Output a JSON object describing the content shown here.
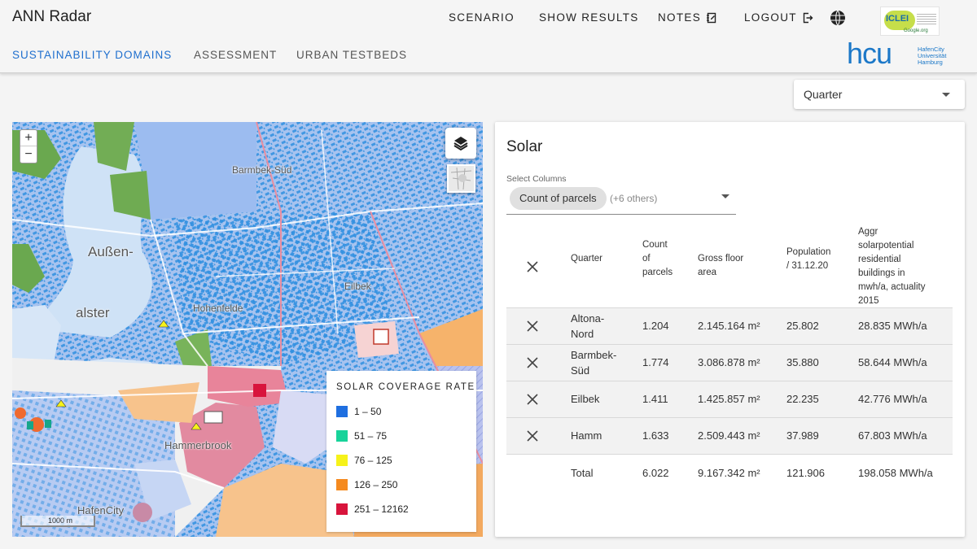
{
  "app": {
    "title": "ANN Radar"
  },
  "topnav": {
    "scenario": "SCENARIO",
    "show_results": "SHOW RESULTS",
    "notes": "NOTES",
    "logout": "LOGOUT"
  },
  "subnav": {
    "sustainability": "SUSTAINABILITY DOMAINS",
    "assessment": "ASSESSMENT",
    "testbeds": "URBAN TESTBEDS"
  },
  "logos": {
    "iclei": "ICLEI",
    "iclei_sub": "Google.org",
    "hcu_mark": "hcu",
    "hcu_text": "HafenCity Universität Hamburg"
  },
  "level_select": {
    "value": "Quarter"
  },
  "map": {
    "zoom_in": "+",
    "zoom_out": "−",
    "scale": "1000 m",
    "labels": {
      "aussen": "Außen-",
      "alster": "alster",
      "hammerbrook": "Hammerbrook",
      "hafencity": "HafenCity",
      "barmbek": "Barmbek-Süd",
      "hohenfelde": "Hohenfelde",
      "eilbek": "Eilbek"
    },
    "legend": {
      "title": "SOLAR COVERAGE RATE",
      "items": [
        {
          "label": "1 – 50",
          "color": "#1f6fe0"
        },
        {
          "label": "51 – 75",
          "color": "#17d39a"
        },
        {
          "label": "76 – 125",
          "color": "#f6f21a"
        },
        {
          "label": "126 – 250",
          "color": "#f58a1f"
        },
        {
          "label": "251 – 12162",
          "color": "#d8143c"
        }
      ]
    }
  },
  "panel": {
    "title": "Solar",
    "select_label": "Select Columns",
    "chip": "Count of parcels",
    "others": "(+6 others)",
    "headers": {
      "quarter": "Quarter",
      "parcels": [
        "Count",
        "of",
        "parcels"
      ],
      "gfa": [
        "Gross floor",
        "area"
      ],
      "population": [
        "Population",
        "/ 31.12.20"
      ],
      "solar": [
        "Aggr",
        "solarpotential",
        "residential",
        "buildings in",
        "mwh/a, actuality",
        "2015"
      ]
    },
    "rows": [
      {
        "quarter": [
          "Altona-",
          "Nord"
        ],
        "parcels": "1.204",
        "gfa": "2.145.164 m²",
        "population": "25.802",
        "solar": "28.835 MWh/a"
      },
      {
        "quarter": [
          "Barmbek-",
          "Süd"
        ],
        "parcels": "1.774",
        "gfa": "3.086.878 m²",
        "population": "35.880",
        "solar": "58.644 MWh/a"
      },
      {
        "quarter": [
          "Eilbek",
          ""
        ],
        "parcels": "1.411",
        "gfa": "1.425.857 m²",
        "population": "22.235",
        "solar": "42.776 MWh/a"
      },
      {
        "quarter": [
          "Hamm",
          ""
        ],
        "parcels": "1.633",
        "gfa": "2.509.443 m²",
        "population": "37.989",
        "solar": "67.803 MWh/a"
      }
    ],
    "total": {
      "label": "Total",
      "parcels": "6.022",
      "gfa": "9.167.342 m²",
      "population": "121.906",
      "solar": "198.058 MWh/a"
    }
  },
  "colors": {
    "accent": "#1f6fce",
    "hcu_blue": "#1c78c8"
  }
}
